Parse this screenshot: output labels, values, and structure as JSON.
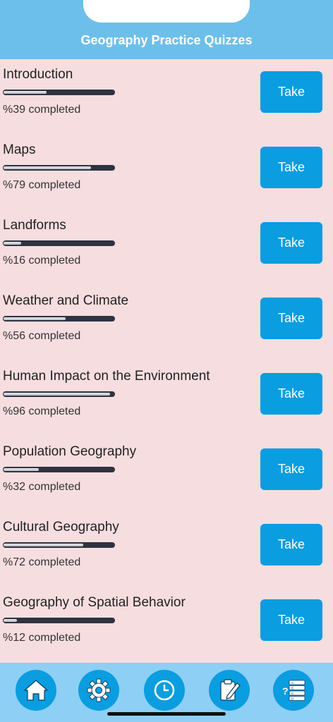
{
  "header": {
    "title": "Geography Practice Quizzes"
  },
  "quizzes": [
    {
      "title": "Introduction",
      "progress": 39,
      "status": "%39 completed",
      "button": "Take"
    },
    {
      "title": "Maps",
      "progress": 79,
      "status": "%79 completed",
      "button": "Take"
    },
    {
      "title": "Landforms",
      "progress": 16,
      "status": "%16 completed",
      "button": "Take"
    },
    {
      "title": "Weather and Climate",
      "progress": 56,
      "status": "%56 completed",
      "button": "Take"
    },
    {
      "title": "Human Impact on the Environment",
      "progress": 96,
      "status": "%96 completed",
      "button": "Take"
    },
    {
      "title": "Population Geography",
      "progress": 32,
      "status": "%32 completed",
      "button": "Take"
    },
    {
      "title": "Cultural Geography",
      "progress": 72,
      "status": "%72 completed",
      "button": "Take"
    },
    {
      "title": "Geography of Spatial Behavior",
      "progress": 12,
      "status": "%12 completed",
      "button": "Take"
    }
  ],
  "tabbar": {
    "items": [
      {
        "icon": "home-icon"
      },
      {
        "icon": "gear-icon"
      },
      {
        "icon": "clock-icon"
      },
      {
        "icon": "clipboard-edit-icon"
      },
      {
        "icon": "quiz-list-icon"
      }
    ]
  },
  "colors": {
    "header": "#6dbfeb",
    "background": "#f6dde0",
    "button": "#0a9de0",
    "tabbar": "#8ecff5"
  }
}
